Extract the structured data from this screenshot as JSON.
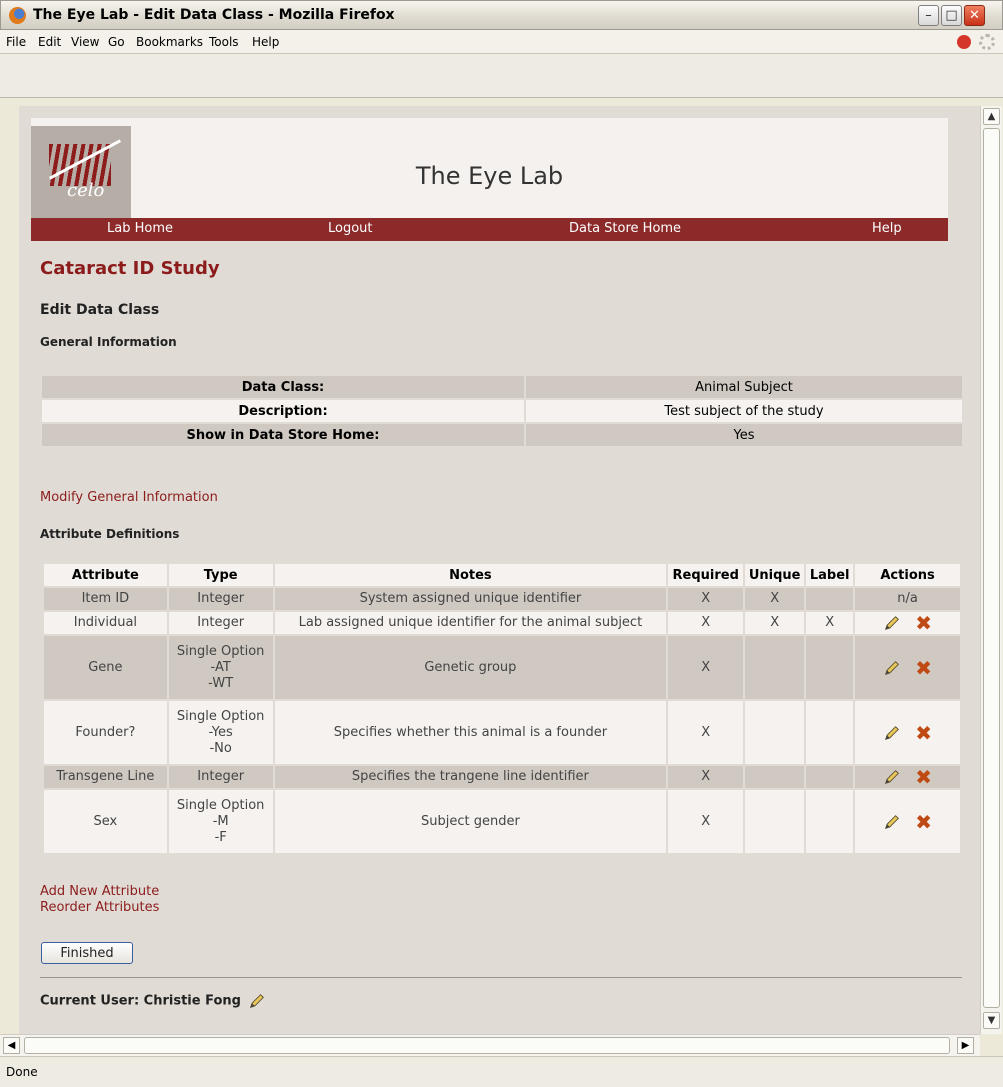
{
  "window": {
    "title": "The Eye Lab - Edit Data Class - Mozilla Firefox"
  },
  "menu": [
    "File",
    "Edit",
    "View",
    "Go",
    "Bookmarks",
    "Tools",
    "Help"
  ],
  "header": {
    "logo_text": "celo",
    "lab_title": "The Eye Lab",
    "nav": [
      "Lab Home",
      "Logout",
      "Data Store Home",
      "Help"
    ]
  },
  "study_title": "Cataract ID Study",
  "page_heading": "Edit Data Class",
  "general_heading": "General Information",
  "general_info": [
    {
      "label": "Data Class:",
      "value": "Animal Subject"
    },
    {
      "label": "Description:",
      "value": "Test subject of the study"
    },
    {
      "label": "Show in Data Store Home:",
      "value": "Yes"
    }
  ],
  "modify_link": "Modify General Information",
  "attributes_heading": "Attribute Definitions",
  "attribute_columns": [
    "Attribute",
    "Type",
    "Notes",
    "Required",
    "Unique",
    "Label",
    "Actions"
  ],
  "attributes": [
    {
      "name": "Item ID",
      "type": [
        "Integer"
      ],
      "notes": "System assigned unique identifier",
      "required": "X",
      "unique": "X",
      "label": "",
      "actions": "n/a"
    },
    {
      "name": "Individual",
      "type": [
        "Integer"
      ],
      "notes": "Lab assigned unique identifier for the animal subject",
      "required": "X",
      "unique": "X",
      "label": "X",
      "actions": "edit-delete"
    },
    {
      "name": "Gene",
      "type": [
        "Single Option",
        "-AT",
        "-WT"
      ],
      "notes": "Genetic group",
      "required": "X",
      "unique": "",
      "label": "",
      "actions": "edit-delete"
    },
    {
      "name": "Founder?",
      "type": [
        "Single Option",
        "-Yes",
        "-No"
      ],
      "notes": "Specifies whether this animal is a founder",
      "required": "X",
      "unique": "",
      "label": "",
      "actions": "edit-delete"
    },
    {
      "name": "Transgene Line",
      "type": [
        "Integer"
      ],
      "notes": "Specifies the trangene line identifier",
      "required": "X",
      "unique": "",
      "label": "",
      "actions": "edit-delete"
    },
    {
      "name": "Sex",
      "type": [
        "Single Option",
        "-M",
        "-F"
      ],
      "notes": "Subject gender",
      "required": "X",
      "unique": "",
      "label": "",
      "actions": "edit-delete"
    }
  ],
  "add_link": "Add New Attribute",
  "reorder_link": "Reorder Attributes",
  "finished_button": "Finished",
  "current_user": "Current User: Christie Fong",
  "status": "Done",
  "icons": {
    "edit": "pencil-icon",
    "delete": "delete-x-icon",
    "delete_color": "#c04a14",
    "accent": "#8c2a2a"
  }
}
